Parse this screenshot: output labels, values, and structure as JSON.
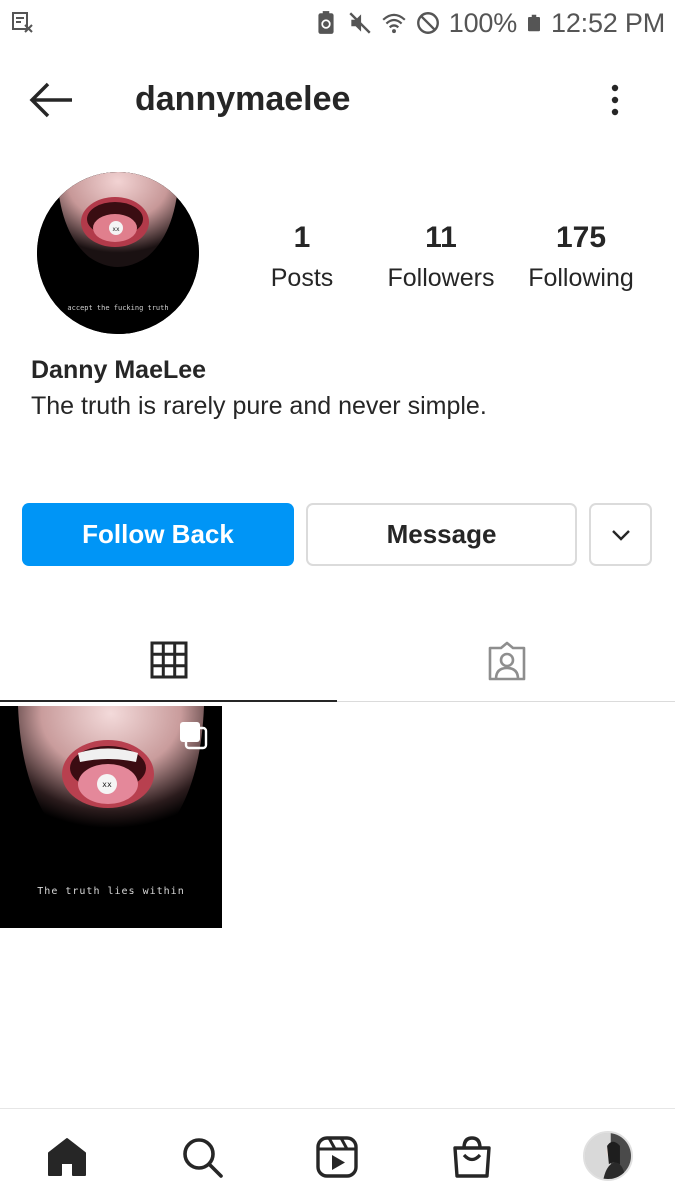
{
  "status_bar": {
    "battery": "100%",
    "time": "12:52 PM"
  },
  "header": {
    "username": "dannymaelee"
  },
  "profile": {
    "avatar_caption": "accept the fucking truth",
    "stats": [
      {
        "value": "1",
        "label": "Posts"
      },
      {
        "value": "11",
        "label": "Followers"
      },
      {
        "value": "175",
        "label": "Following"
      }
    ],
    "name": "Danny MaeLee",
    "bio": "The truth is rarely pure and never simple."
  },
  "actions": {
    "follow_back": "Follow Back",
    "message": "Message"
  },
  "posts": [
    {
      "caption": "The truth lies within"
    }
  ],
  "colors": {
    "accent": "#0095f6",
    "text": "#262626",
    "border": "#dbdbdb"
  }
}
